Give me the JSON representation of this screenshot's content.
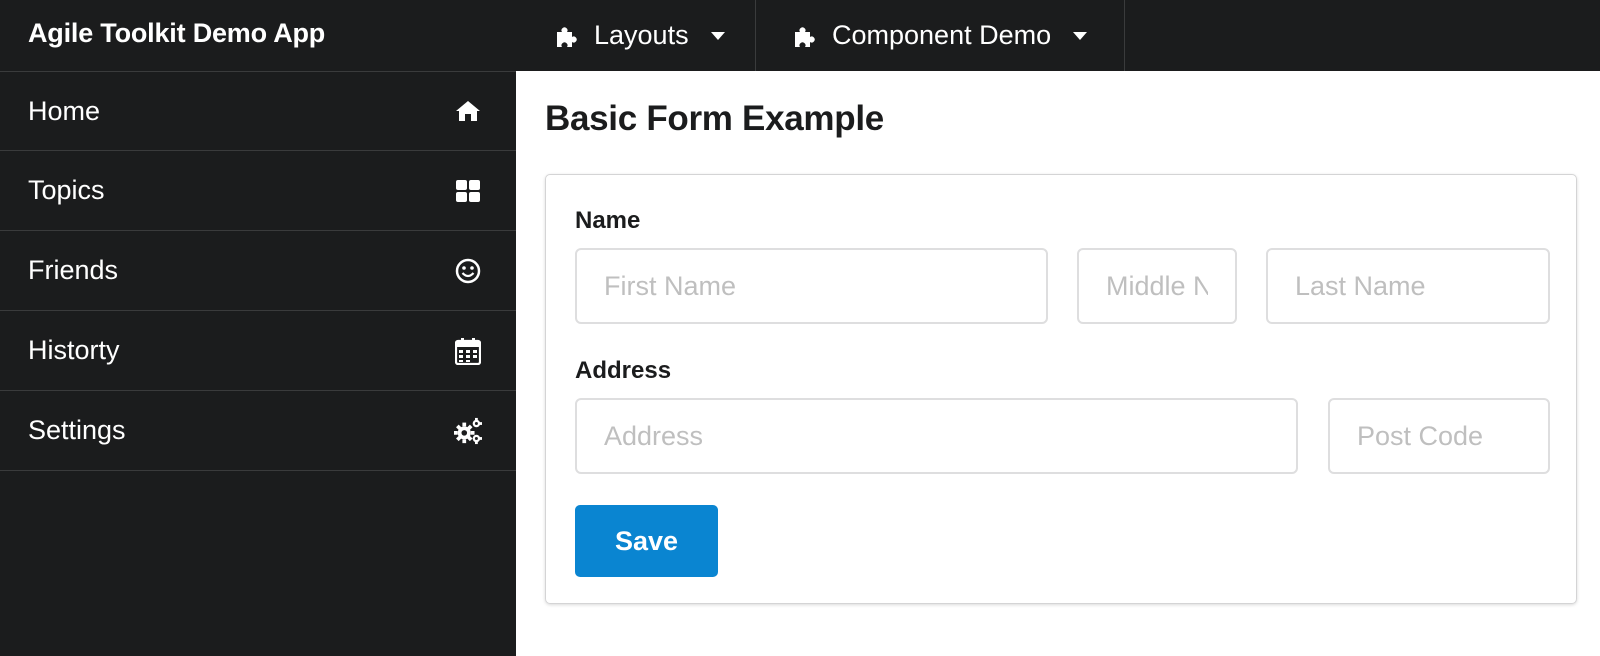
{
  "app": {
    "title": "Agile Toolkit Demo App"
  },
  "topmenu": [
    {
      "label": "Layouts",
      "icon": "puzzle-icon"
    },
    {
      "label": "Component Demo",
      "icon": "puzzle-icon"
    }
  ],
  "sidebar": {
    "items": [
      {
        "label": "Home",
        "icon": "home-icon"
      },
      {
        "label": "Topics",
        "icon": "grid-icon"
      },
      {
        "label": "Friends",
        "icon": "smile-icon"
      },
      {
        "label": "Historty",
        "icon": "calendar-icon"
      },
      {
        "label": "Settings",
        "icon": "cogs-icon"
      }
    ]
  },
  "main": {
    "title": "Basic Form Example",
    "form": {
      "name_label": "Name",
      "first_name": {
        "placeholder": "First Name",
        "value": ""
      },
      "middle_name": {
        "placeholder": "Middle Name",
        "value": ""
      },
      "last_name": {
        "placeholder": "Last Name",
        "value": ""
      },
      "address_label": "Address",
      "address": {
        "placeholder": "Address",
        "value": ""
      },
      "post_code": {
        "placeholder": "Post Code",
        "value": ""
      },
      "save_label": "Save"
    }
  },
  "colors": {
    "nav_bg": "#1b1c1d",
    "primary_button": "#0a85d1",
    "divider": "#3a3b3c"
  }
}
